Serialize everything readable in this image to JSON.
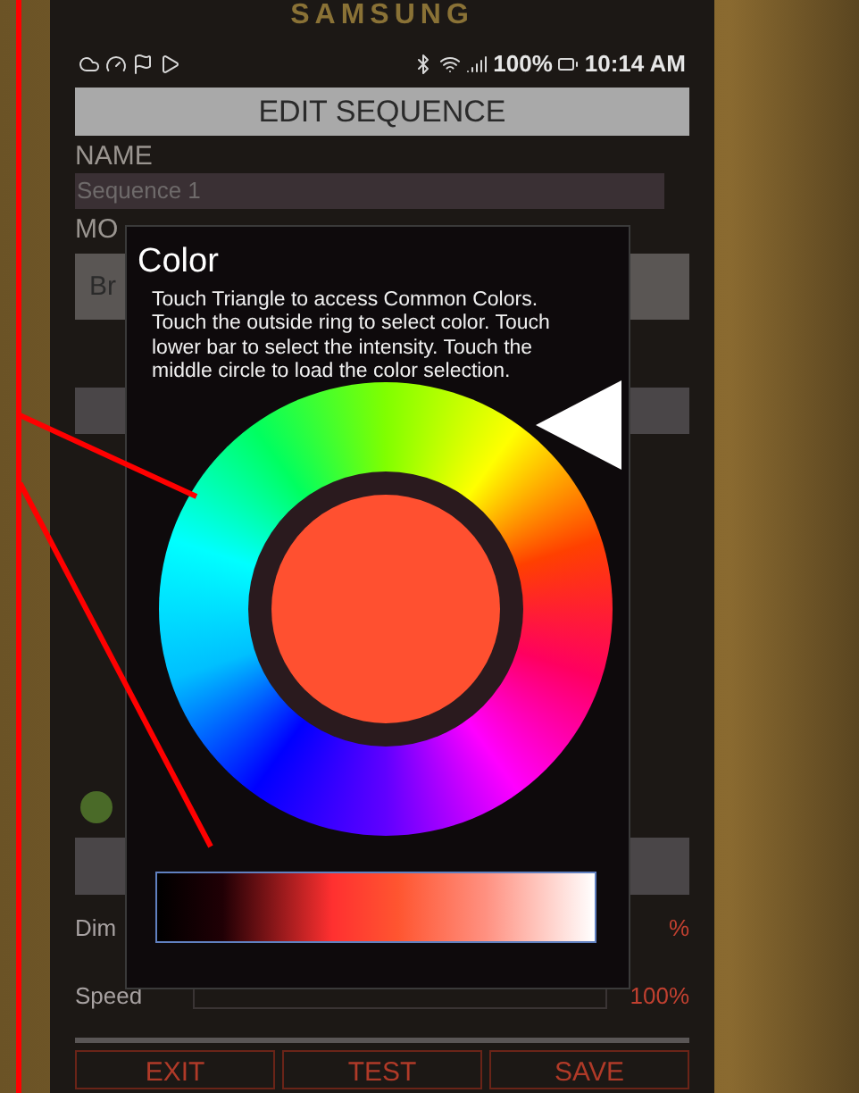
{
  "device": {
    "brand": "SAMSUNG"
  },
  "status_bar": {
    "battery": "100%",
    "time": "10:14 AM"
  },
  "header": {
    "title": "EDIT SEQUENCE"
  },
  "form": {
    "name_label": "NAME",
    "name_value": "Sequence 1",
    "mode_label": "MO",
    "mode_value": "Br"
  },
  "sliders": [
    {
      "label": "Dim",
      "reading": "%"
    },
    {
      "label": "Speed",
      "reading": "100%"
    }
  ],
  "buttons": [
    "EXIT",
    "TEST",
    "SAVE"
  ],
  "dialog": {
    "title": "Color",
    "text": "Touch Triangle to access Common Colors. Touch the outside ring to select color. Touch lower bar to select the intensity. Touch the middle circle to load the color selection."
  }
}
